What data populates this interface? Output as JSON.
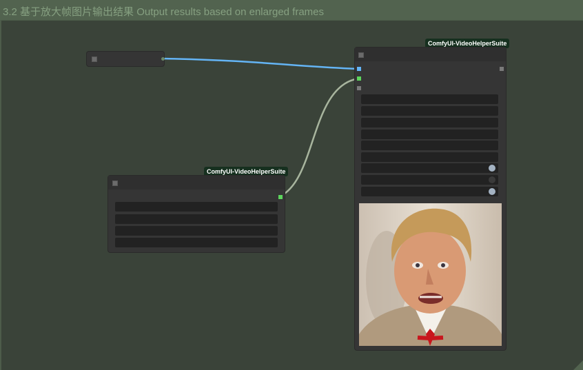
{
  "group": {
    "title": "3.2 基于放大帧图片输出结果   Output results based on enlarged frames"
  },
  "nodes": {
    "reroute": {},
    "loader_node": {
      "badge": "ComfyUI-VideoHelperSuite"
    },
    "combine_node": {
      "badge": "ComfyUI-VideoHelperSuite"
    }
  },
  "colors": {
    "canvas_bg": "#3a4339",
    "group_header": "#52634f",
    "group_title_text": "#86a081",
    "wire_image": "#64b5f6",
    "wire_audio": "#a8b59e",
    "slot_image": "#64b5f6",
    "slot_audio": "#5dd55d",
    "badge_bg": "#16301f"
  },
  "preview": {
    "description_icon": "output-preview-image"
  }
}
